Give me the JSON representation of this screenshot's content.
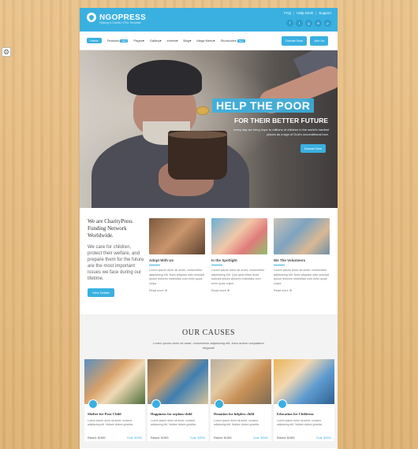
{
  "header": {
    "logo_text": "NGOPRESS",
    "logo_tagline": "Helping & Charity HTML Template",
    "top_links": [
      "FAQ",
      "Help Desk",
      "Support"
    ],
    "socials": [
      "facebook-icon",
      "twitter-icon",
      "google-plus-icon",
      "linkedin-icon",
      "pinterest-icon"
    ],
    "social_glyphs": [
      "f",
      "t",
      "g",
      "in",
      "p"
    ]
  },
  "nav": {
    "items": [
      {
        "label": "Home",
        "badge": ""
      },
      {
        "label": "Features",
        "badge": "New"
      },
      {
        "label": "Pages",
        "badge": ""
      },
      {
        "label": "Gallery",
        "badge": ""
      },
      {
        "label": "events",
        "badge": ""
      },
      {
        "label": "Blog",
        "badge": ""
      },
      {
        "label": "Mega Menu",
        "badge": ""
      },
      {
        "label": "Shortcodes",
        "badge": "New"
      }
    ],
    "donate_label": "Donate Now",
    "join_label": "Join Us"
  },
  "hero": {
    "title": "HELP THE POOR",
    "subtitle": "FOR THEIR BETTER FUTURE",
    "text": "every day we bring hope to millions of children in the world's hardest places as a sign of God's unconditional love.",
    "button": "Donate Now"
  },
  "intro": {
    "title": "We are CharityPress Funding Network Worldwide.",
    "body": "We care for children, protect their welfare, and prepare them for the future are the most important issues we face during our lifetime.",
    "button": "View Details"
  },
  "features": [
    {
      "title": "Adopt With Us",
      "body": "Lorem ipsum dolor sit amet, consectetur adipisicing elit. Nam aliquam odio suscipit ipsum dolores molestias cum enim quas culpa.",
      "more": "Read more"
    },
    {
      "title": "In the Spotlight",
      "body": "Lorem ipsum dolor sit amet, consectetur adipisicing elit. Quo ipsa ullam dicta suscipit ipsum dolores molestias cum enim quas culpa.",
      "more": "Read more"
    },
    {
      "title": "We The Volunteers",
      "body": "Lorem ipsum dolor sit amet, consectetur adipisicing elit. Nam aliquam odio suscipit ipsum dolores molestias cum enim quas culpa.",
      "more": "Read more"
    }
  ],
  "causes": {
    "title": "OUR CAUSES",
    "subtitle": "Lorem ipsum dolor sit amet, consectetur adipisicing elit. Nam autem voluptatem eleganti!",
    "items": [
      {
        "title": "Shelter for Poor Child",
        "body": "Lorem ipsum dolor sit amet, consect adipiscing elit. Nullam dolore gravida.",
        "raised": "Raised: $1890",
        "goal": "Goal: $2500"
      },
      {
        "title": "Happiness for orphan child",
        "body": "Lorem ipsum dolor sit amet, consect adipiscing elit. Nullam dolore gravida.",
        "raised": "Raised: $1890",
        "goal": "Goal: $2500"
      },
      {
        "title": "Donation for helpless child",
        "body": "Lorem ipsum dolor sit amet, consect adipiscing elit. Nullam dolore gravida.",
        "raised": "Raised: $1890",
        "goal": "Goal: $2500"
      },
      {
        "title": "Education for Childrens",
        "body": "Lorem ipsum dolor sit amet, consect adipiscing elit. Nullam dolore gravida.",
        "raised": "Raised: $1890",
        "goal": "Goal: $2500"
      }
    ]
  },
  "colors": {
    "accent": "#3ab0e0",
    "background_wood": "#e3b97e"
  }
}
